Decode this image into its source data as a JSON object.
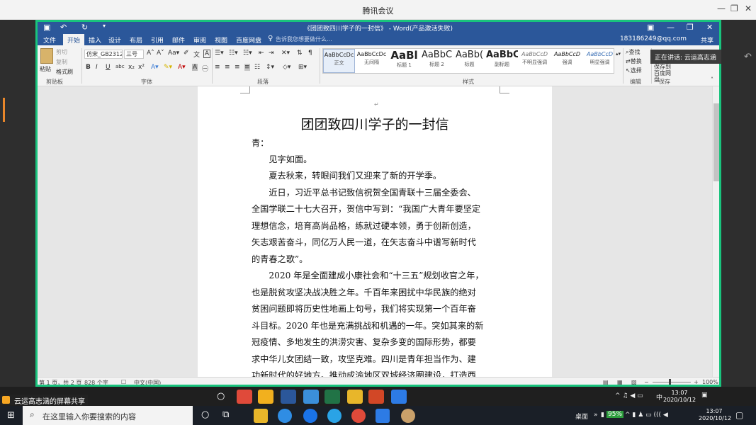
{
  "meeting": {
    "window_title": "腾讯会议",
    "speaking": "正在讲话: 云运高志涵",
    "share_label": "云运高志涵的屏幕共享"
  },
  "word": {
    "doc_title": "《团团致四川学子的一封信》 - Word(产品激活失败)",
    "account": "183186249@qq.com",
    "share": "共享",
    "search_hint": "告诉我您想要做什么...",
    "tabs": [
      "文件",
      "开始",
      "插入",
      "设计",
      "布局",
      "引用",
      "邮件",
      "审阅",
      "视图",
      "百度网盘"
    ],
    "active_tab": "开始",
    "clipboard": {
      "paste": "粘贴",
      "cut": "剪切",
      "copy": "复制",
      "format_painter": "格式刷",
      "label": "剪贴板"
    },
    "font": {
      "name": "仿宋_GB2312",
      "size": "三号",
      "label": "字体"
    },
    "paragraph_label": "段落",
    "styles": [
      {
        "preview": "AaBbCcDc",
        "name": "正文"
      },
      {
        "preview": "AaBbCcDc",
        "name": "无间隔"
      },
      {
        "preview": "AaBl",
        "name": "标题 1"
      },
      {
        "preview": "AaBbC",
        "name": "标题 2"
      },
      {
        "preview": "AaBb(",
        "name": "标题"
      },
      {
        "preview": "AaBbC",
        "name": "副标题"
      },
      {
        "preview": "AaBbCcD",
        "name": "不明显强调"
      },
      {
        "preview": "AaBbCcD",
        "name": "强调"
      },
      {
        "preview": "AaBbCcD",
        "name": "明显强调"
      }
    ],
    "styles_label": "样式",
    "editing": {
      "find": "查找",
      "replace": "替换",
      "select": "选择",
      "label": "编辑"
    },
    "save": {
      "button": "保存到百度网盘",
      "label": "保存"
    }
  },
  "document": {
    "title": "团团致四川学子的一封信",
    "lines": [
      "青：",
      "　　见字如面。",
      "　　夏去秋来，转眼间我们又迎来了新的开学季。",
      "　　近日，习近平总书记致信祝贺全国青联十三届全委会、",
      "全国学联二十七大召开，贺信中写到：“我国广大青年要坚定",
      "理想信念，培育高尚品格，练就过硬本领，勇于创新创造，",
      "矢志艰苦奋斗，同亿万人民一道，在矢志奋斗中谱写新时代",
      "的青春之歌”。",
      "　　2020 年是全面建成小康社会和“十三五”规划收官之年，",
      "也是脱贫攻坚决战决胜之年。千百年来困扰中华民族的绝对",
      "贫困问题即将历史性地画上句号，我们将实现第一个百年奋",
      "斗目标。2020 年也是充满挑战和机遇的一年。突如其来的新",
      "冠疫情、多地发生的洪涝灾害、复杂多变的国际形势，都要",
      "求中华儿女团结一致，攻坚克难。四川是青年担当作为、建",
      "功新时代的好地方。推动成渝地区双城经济圈建设，打造西"
    ]
  },
  "status": {
    "pages": "第 1 页，共 2 页",
    "words": "828 个字",
    "lang": "中文(中国)",
    "zoom": "100%"
  },
  "taskbar": {
    "search_placeholder": "在这里输入你要搜索的内容",
    "desktop": "桌面",
    "battery": "95%",
    "ime": "中",
    "time": "13:07",
    "date": "2020/10/12"
  }
}
